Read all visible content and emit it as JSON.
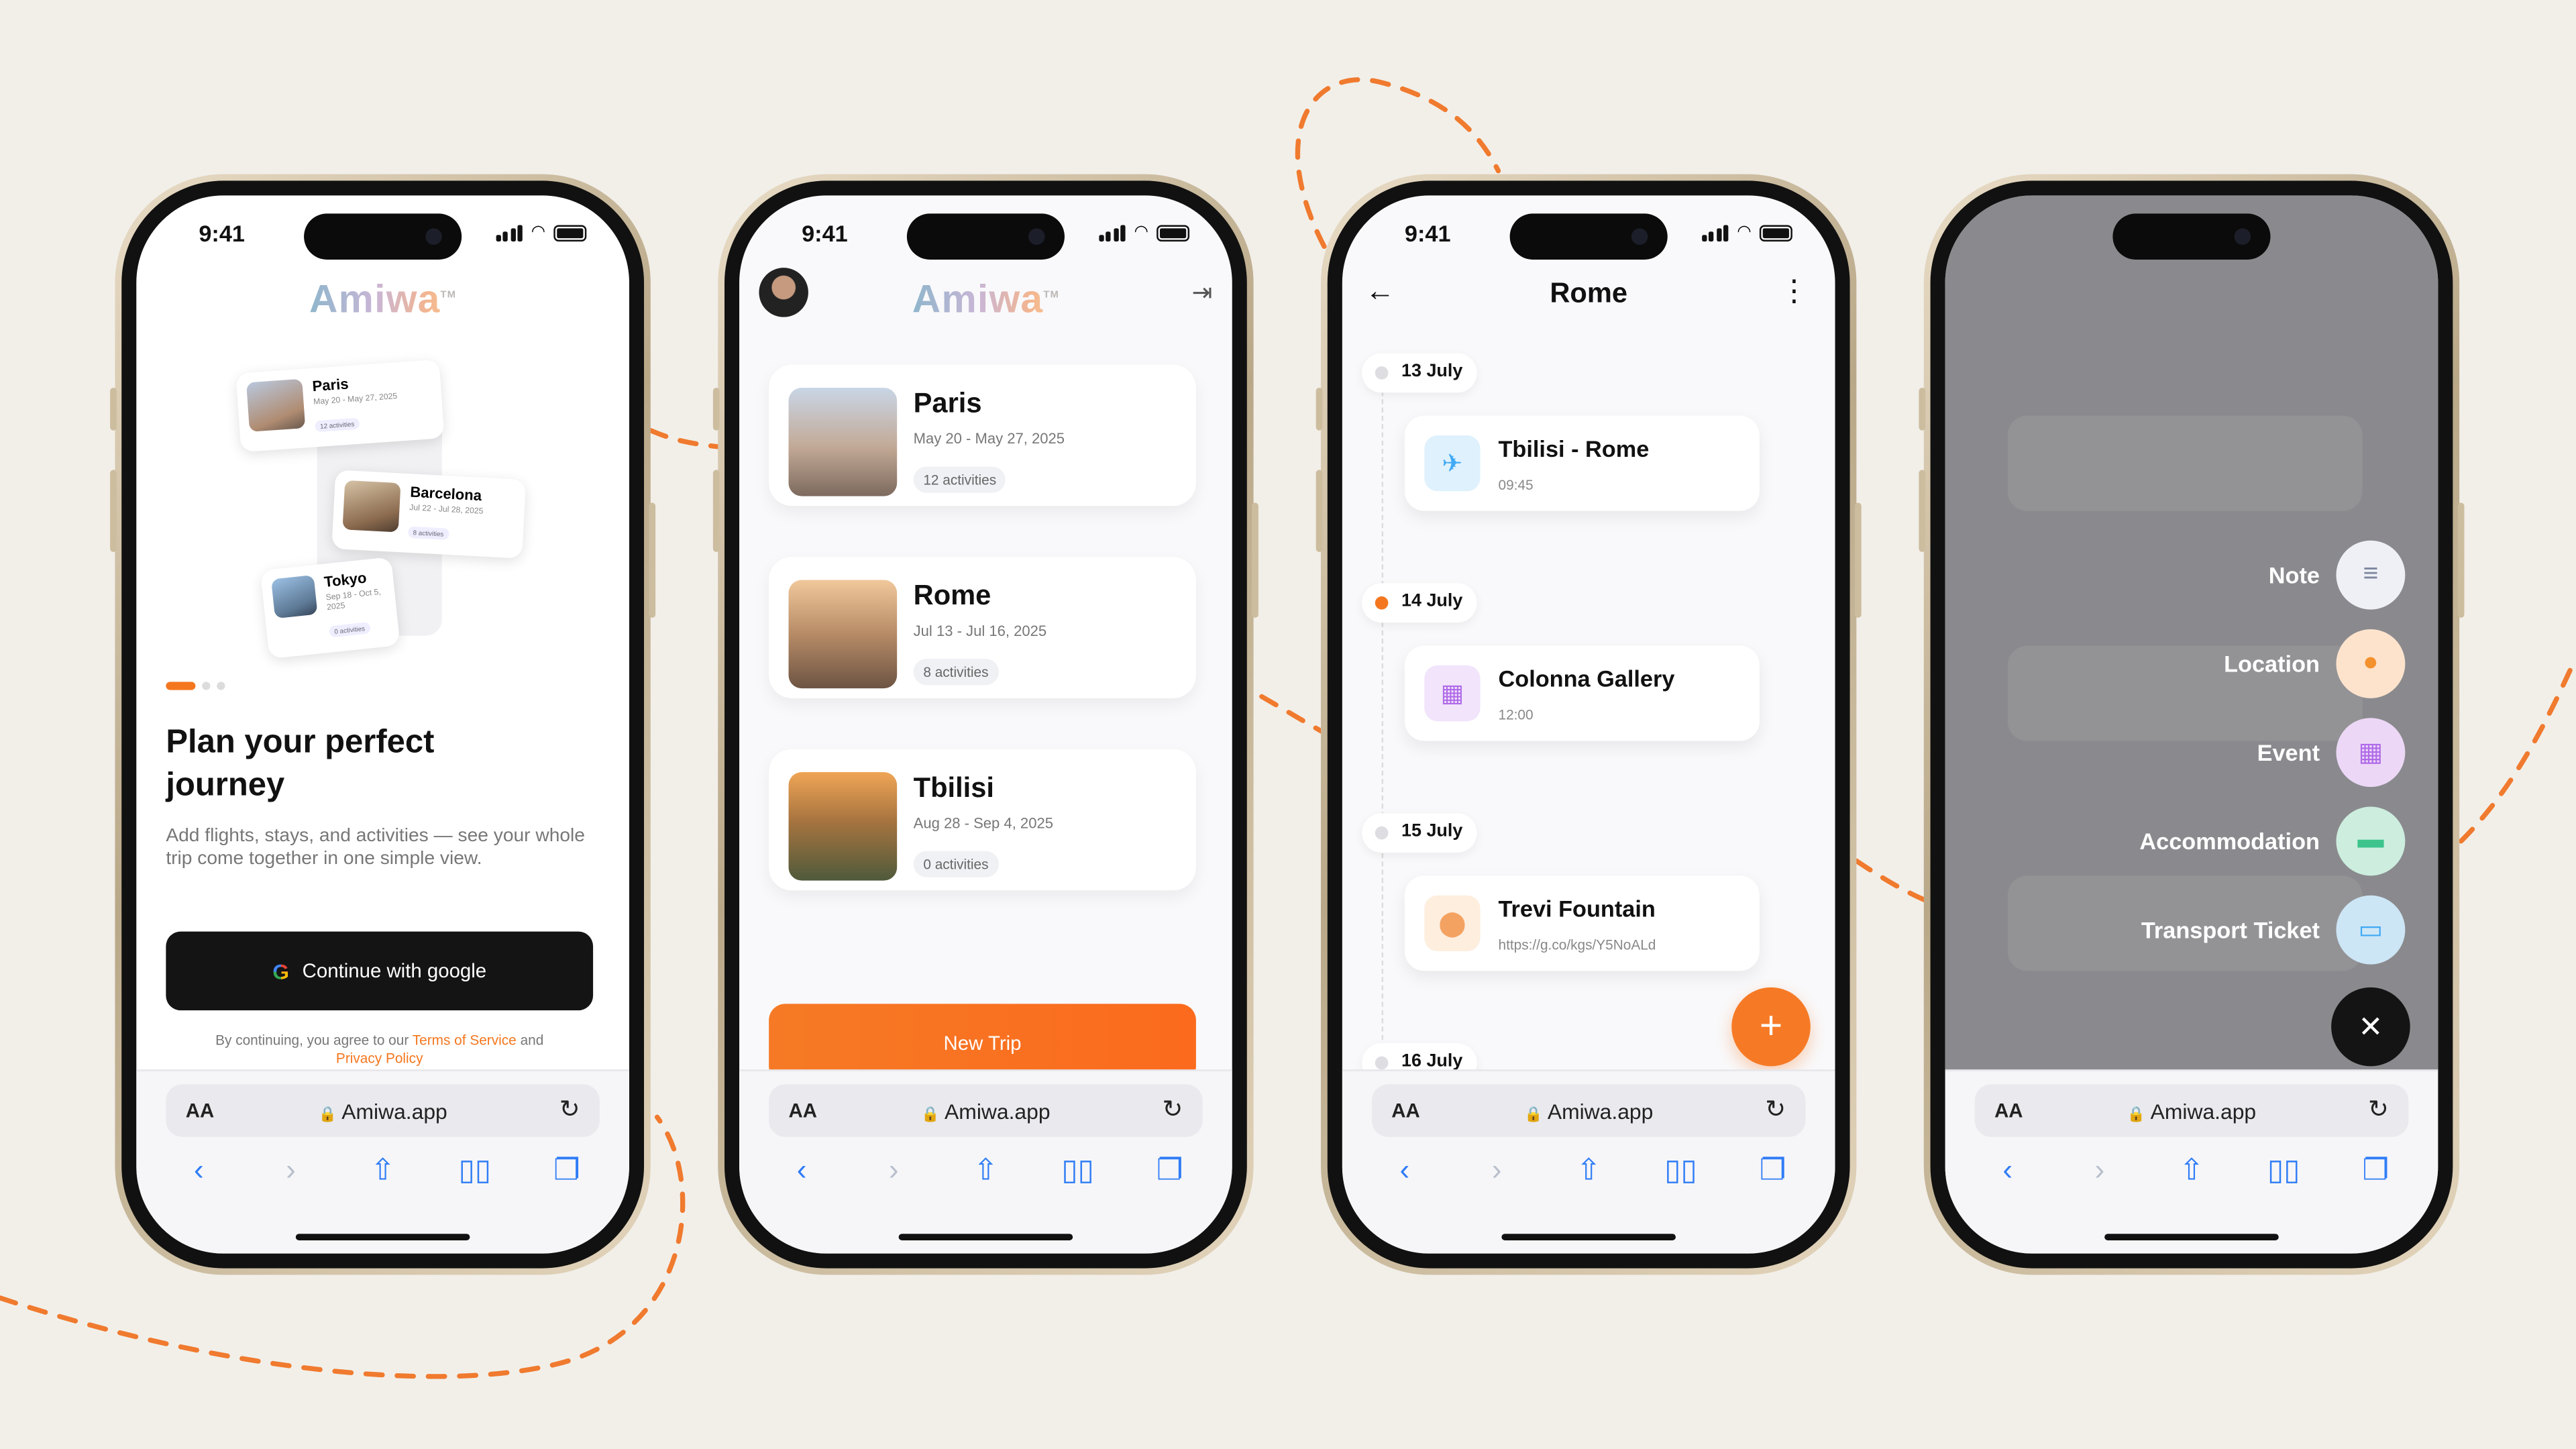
{
  "status": {
    "time": "9:41"
  },
  "browser": {
    "text_size": "AA",
    "url": "Amiwa.app"
  },
  "logo": {
    "text": "Amiwa",
    "tm": "TM"
  },
  "onboarding": {
    "mini_cards": [
      {
        "name": "Paris",
        "dates": "May 20 - May 27, 2025",
        "badge": "12 activities"
      },
      {
        "name": "Barcelona",
        "dates": "Jul 22 - Jul 28, 2025",
        "badge": "8 activities"
      },
      {
        "name": "Tokyo",
        "dates": "Sep 18 - Oct 5, 2025",
        "badge": "0 activities"
      }
    ],
    "title": "Plan your perfect journey",
    "subtitle": "Add flights, stays, and activities — see your whole trip come together in one simple view.",
    "google_button": "Continue with google",
    "terms_prefix": "By continuing, you agree to our",
    "terms_link": "Terms of Service",
    "terms_and": "and",
    "privacy_link": "Privacy Policy"
  },
  "trips": {
    "items": [
      {
        "name": "Paris",
        "dates": "May 20 - May 27, 2025",
        "badge": "12 activities"
      },
      {
        "name": "Rome",
        "dates": "Jul 13 - Jul 16, 2025",
        "badge": "8 activities"
      },
      {
        "name": "Tbilisi",
        "dates": "Aug 28 - Sep 4, 2025",
        "badge": "0 activities"
      }
    ],
    "new_trip": "New Trip"
  },
  "timeline": {
    "title": "Rome",
    "days": [
      {
        "label": "13 July",
        "event": {
          "name": "Tbilisi - Rome",
          "sub": "09:45",
          "icon": "plane-icon",
          "color": "#3fa9f5"
        }
      },
      {
        "label": "14 July",
        "event": {
          "name": "Colonna Gallery",
          "sub": "12:00",
          "icon": "calendar-icon",
          "color": "#b06ae8"
        }
      },
      {
        "label": "15 July",
        "event": {
          "name": "Trevi Fountain",
          "sub": "https://g.co/kgs/Y5NoALd",
          "icon": "pin-icon",
          "color": "#f4a261"
        }
      },
      {
        "label": "16 July"
      }
    ]
  },
  "add_menu": {
    "items": [
      {
        "label": "Note",
        "icon": "note-icon",
        "color": "#eef0f5"
      },
      {
        "label": "Location",
        "icon": "pin-icon",
        "color": "#fde3cc"
      },
      {
        "label": "Event",
        "icon": "calendar-icon",
        "color": "#ecd8f6"
      },
      {
        "label": "Accommodation",
        "icon": "bed-icon",
        "color": "#cdeedf"
      },
      {
        "label": "Transport Ticket",
        "icon": "ticket-icon",
        "color": "#cde6f6"
      }
    ]
  },
  "colors": {
    "accent": "#f67a25",
    "background": "#f2efe9"
  }
}
